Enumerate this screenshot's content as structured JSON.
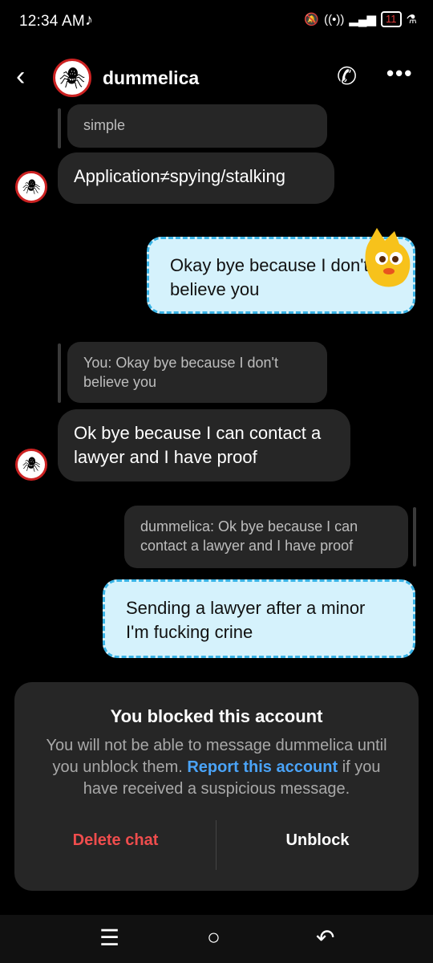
{
  "status_bar": {
    "time": "12:34 AM",
    "battery": "11"
  },
  "header": {
    "username": "dummelica"
  },
  "messages": {
    "partial_top": "simple",
    "m1_text": "Application≠spying/stalking",
    "m2_text": "Okay bye because I don't believe you",
    "m3_quote": "You: Okay bye because I don't believe you",
    "m3_text": "Ok bye because I can contact a lawyer and I have proof",
    "m4_quote": "dummelica: Ok bye because I can contact a lawyer and I have proof",
    "m4_text": "Sending a lawyer after a minor I'm fucking crine"
  },
  "blocked": {
    "title": "You blocked this account",
    "text_1": "You will not be able to message dummelica until you unblock them. ",
    "link": "Report this account",
    "text_2": " if you have received a suspicious message.",
    "delete_label": "Delete chat",
    "unblock_label": "Unblock"
  },
  "colors": {
    "outgoing_bubble": "#d5f2fc",
    "outgoing_border": "#39b3e6",
    "link": "#4aa3f7",
    "delete": "#ef4d4d"
  }
}
